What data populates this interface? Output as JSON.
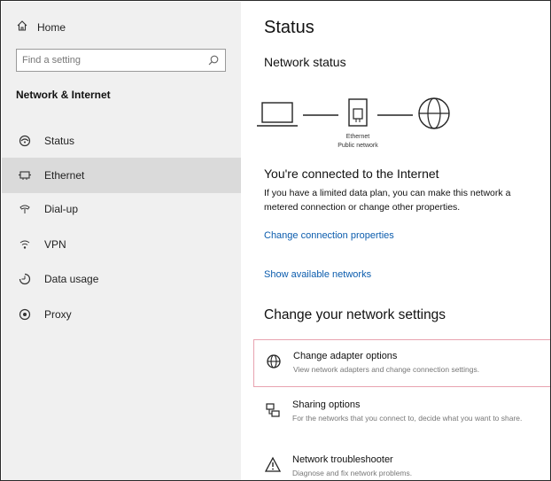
{
  "sidebar": {
    "home_label": "Home",
    "search_placeholder": "Find a setting",
    "section_title": "Network & Internet",
    "items": [
      {
        "label": "Status",
        "icon": "status-icon"
      },
      {
        "label": "Ethernet",
        "icon": "ethernet-icon"
      },
      {
        "label": "Dial-up",
        "icon": "dialup-icon"
      },
      {
        "label": "VPN",
        "icon": "vpn-icon"
      },
      {
        "label": "Data usage",
        "icon": "data-usage-icon"
      },
      {
        "label": "Proxy",
        "icon": "proxy-icon"
      }
    ],
    "selected_index": 1
  },
  "main": {
    "title": "Status",
    "network_status_heading": "Network status",
    "diagram": {
      "device_label": "Ethernet",
      "network_label": "Public network"
    },
    "connected_heading": "You're connected to the Internet",
    "connected_desc_line1": "If you have a limited data plan, you can make this network a",
    "connected_desc_line2": "metered connection or change other properties.",
    "link_change_props": "Change connection properties",
    "link_show_networks": "Show available networks",
    "change_settings_heading": "Change your network settings",
    "options": [
      {
        "title": "Change adapter options",
        "desc": "View network adapters and change connection settings.",
        "icon": "adapter-icon"
      },
      {
        "title": "Sharing options",
        "desc": "For the networks that you connect to, decide what you want to share.",
        "icon": "sharing-icon"
      },
      {
        "title": "Network troubleshooter",
        "desc": "Diagnose and fix network problems.",
        "icon": "troubleshooter-icon"
      }
    ]
  },
  "colors": {
    "accent": "#0067c0",
    "link": "#0b5cad",
    "sidebar_bg": "#f0f0f0",
    "selected_bg": "#dadada",
    "focus_border": "#e8a3b0"
  }
}
